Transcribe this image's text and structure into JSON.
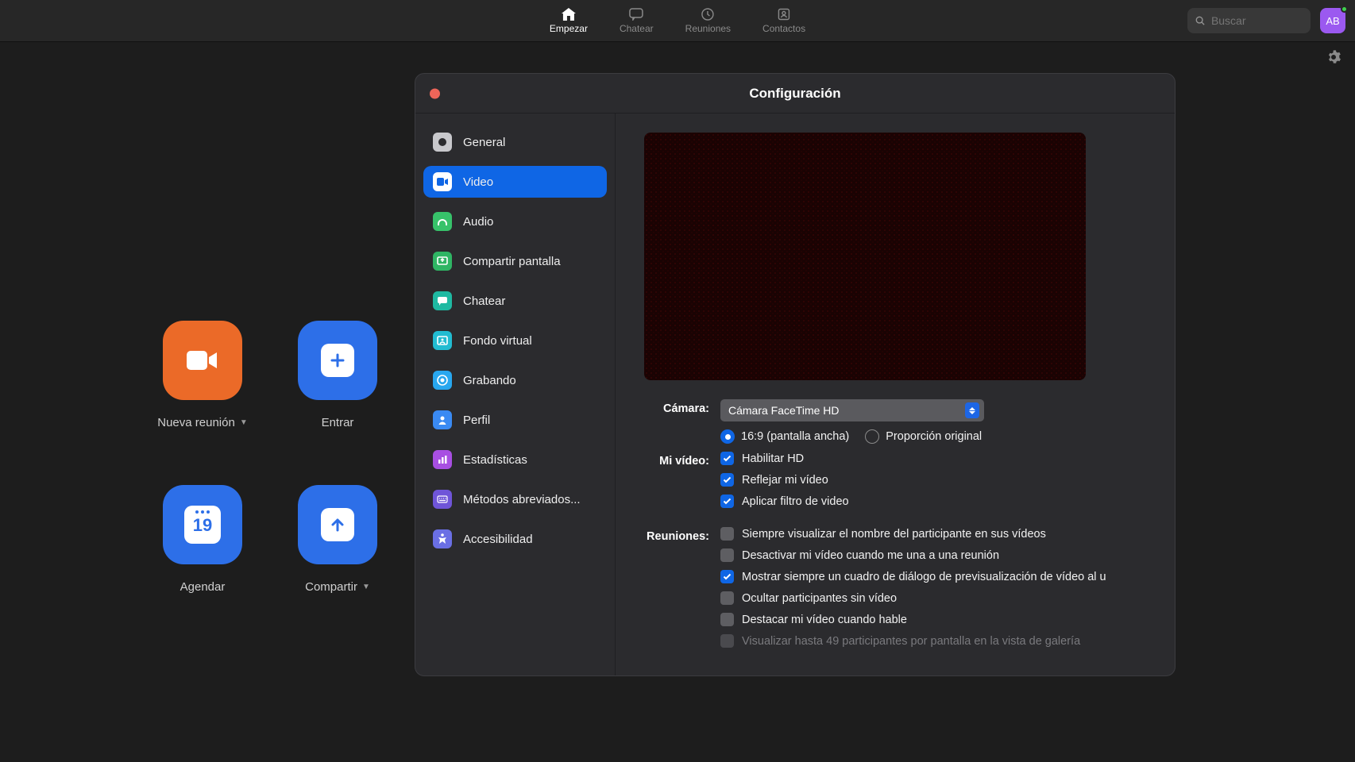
{
  "nav": {
    "tabs": [
      {
        "label": "Empezar",
        "active": true
      },
      {
        "label": "Chatear",
        "active": false
      },
      {
        "label": "Reuniones",
        "active": false
      },
      {
        "label": "Contactos",
        "active": false
      }
    ],
    "search_placeholder": "Buscar",
    "avatar_initials": "AB"
  },
  "home": {
    "new_meeting": "Nueva reunión",
    "join": "Entrar",
    "schedule": "Agendar",
    "schedule_day": "19",
    "share": "Compartir"
  },
  "settings": {
    "title": "Configuración",
    "side": [
      {
        "label": "General",
        "color": "#c8c8cc",
        "active": false
      },
      {
        "label": "Video",
        "color": "#0f66e5",
        "active": true
      },
      {
        "label": "Audio",
        "color": "#37c26a",
        "active": false
      },
      {
        "label": "Compartir pantalla",
        "color": "#2fb564",
        "active": false
      },
      {
        "label": "Chatear",
        "color": "#1fb9a2",
        "active": false
      },
      {
        "label": "Fondo virtual",
        "color": "#22bcd1",
        "active": false
      },
      {
        "label": "Grabando",
        "color": "#28a7ef",
        "active": false
      },
      {
        "label": "Perfil",
        "color": "#3a8af3",
        "active": false
      },
      {
        "label": "Estadísticas",
        "color": "#a84fe2",
        "active": false
      },
      {
        "label": "Métodos abreviados...",
        "color": "#6f55d8",
        "active": false
      },
      {
        "label": "Accesibilidad",
        "color": "#6a6fe4",
        "active": false
      }
    ],
    "video": {
      "camera_label": "Cámara:",
      "camera_value": "Cámara FaceTime HD",
      "aspect_169": "16:9 (pantalla ancha)",
      "aspect_orig": "Proporción original",
      "my_video_label": "Mi vídeo:",
      "enable_hd": "Habilitar HD",
      "mirror": "Reflejar mi vídeo",
      "filter": "Aplicar filtro de video",
      "meetings_label": "Reuniones:",
      "show_name": "Siempre visualizar el nombre del participante en sus vídeos",
      "disable_join": "Desactivar mi vídeo cuando me una a una reunión",
      "preview_dlg": "Mostrar siempre un cuadro de diálogo de previsualización de vídeo al u",
      "hide_nonvideo": "Ocultar participantes sin vídeo",
      "spotlight": "Destacar mi vídeo cuando hable",
      "gallery49": "Visualizar hasta 49 participantes por pantalla en la vista de galería"
    }
  }
}
